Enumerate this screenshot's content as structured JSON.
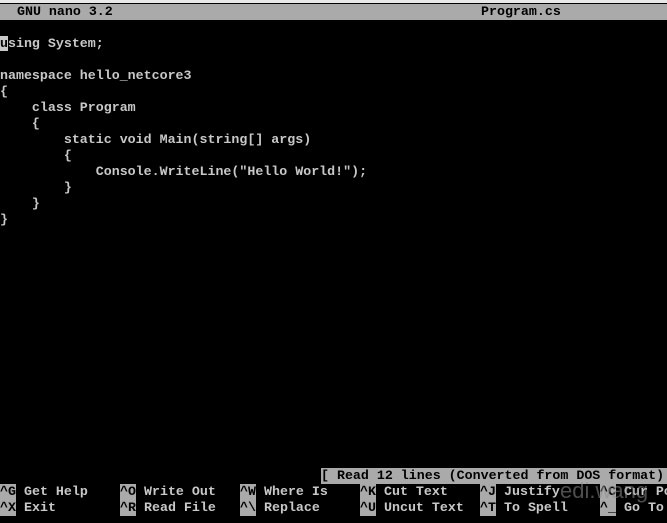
{
  "titlebar": {
    "app": "GNU nano 3.2",
    "filename": "Program.cs"
  },
  "editor": {
    "lines": [
      {
        "first": "u",
        "rest": "sing System;"
      },
      {
        "text": ""
      },
      {
        "text": "namespace hello_netcore3"
      },
      {
        "text": "{"
      },
      {
        "text": "    class Program"
      },
      {
        "text": "    {"
      },
      {
        "text": "        static void Main(string[] args)"
      },
      {
        "text": "        {"
      },
      {
        "text": "            Console.WriteLine(\"Hello World!\");"
      },
      {
        "text": "        }"
      },
      {
        "text": "    }"
      },
      {
        "text": "}"
      }
    ]
  },
  "status": "[ Read 12 lines (Converted from DOS format) ]",
  "shortcuts": [
    {
      "key": "^G",
      "label": "Get Help"
    },
    {
      "key": "^O",
      "label": "Write Out"
    },
    {
      "key": "^W",
      "label": "Where Is"
    },
    {
      "key": "^K",
      "label": "Cut Text"
    },
    {
      "key": "^J",
      "label": "Justify"
    },
    {
      "key": "^C",
      "label": "Cur Pos"
    },
    {
      "key": "^X",
      "label": "Exit"
    },
    {
      "key": "^R",
      "label": "Read File"
    },
    {
      "key": "^\\",
      "label": "Replace"
    },
    {
      "key": "^U",
      "label": "Uncut Text"
    },
    {
      "key": "^T",
      "label": "To Spell"
    },
    {
      "key": "^_",
      "label": "Go To Line"
    }
  ],
  "watermark": "edi.wang"
}
